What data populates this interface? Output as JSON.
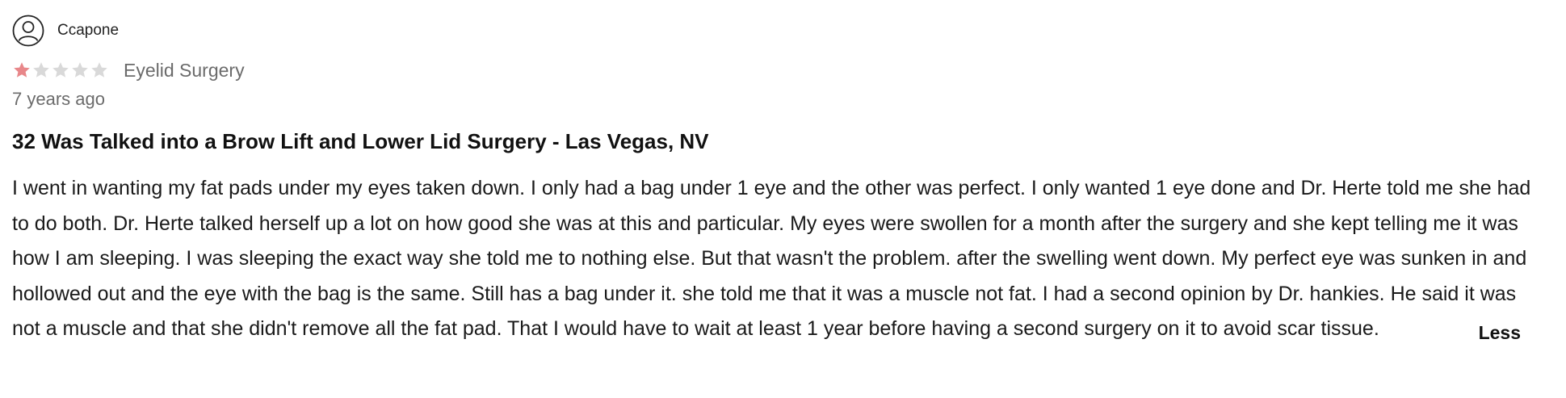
{
  "review": {
    "author": {
      "name": "Ccapone",
      "avatar_icon": "user-circle-icon"
    },
    "rating": {
      "value": 1,
      "max": 5,
      "filled_color": "#e8878a",
      "empty_color": "#d9d9d9"
    },
    "procedure": "Eyelid Surgery",
    "time_ago": "7 years ago",
    "title": "32 Was Talked into a Brow Lift and Lower Lid Surgery - Las Vegas, NV",
    "body": "I went in wanting my fat pads under my eyes taken down. I only had a bag under 1 eye and the other was perfect. I only wanted 1 eye done and Dr. Herte told me she had to do both. Dr. Herte talked herself up a lot on how good she was at this and particular. My eyes were swollen for a month after the surgery and she kept telling me it was how I am sleeping. I was sleeping the exact way she told me to nothing else. But that wasn't the problem. after the swelling went down. My perfect eye was sunken in and hollowed out and the eye with the bag is the same. Still has a bag under it. she told me that it was a muscle not fat. I had a second opinion by Dr. hankies. He said it was not a muscle and that she didn't remove all the fat pad. That I would have to wait at least 1 year before having a second surgery on it to avoid scar tissue.",
    "toggle_label": "Less"
  }
}
